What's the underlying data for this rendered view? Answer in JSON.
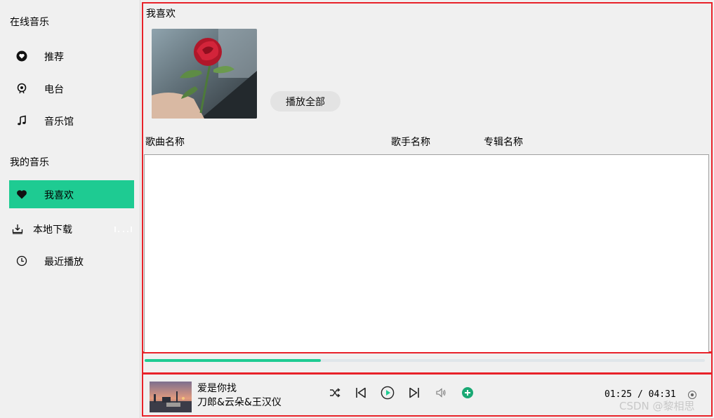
{
  "sidebar": {
    "online_title": "在线音乐",
    "online_items": [
      {
        "label": "推荐",
        "icon": "heart-circle-icon"
      },
      {
        "label": "电台",
        "icon": "radio-icon"
      },
      {
        "label": "音乐馆",
        "icon": "music-note-icon"
      }
    ],
    "my_title": "我的音乐",
    "my_items": [
      {
        "label": "我喜欢",
        "icon": "heart-icon",
        "active": true
      },
      {
        "label": "本地下载",
        "icon": "download-icon"
      },
      {
        "label": "最近播放",
        "icon": "clock-icon"
      }
    ]
  },
  "main": {
    "title": "我喜欢",
    "play_all": "播放全部",
    "columns": [
      "歌曲名称",
      "歌手名称",
      "专辑名称"
    ]
  },
  "progress": {
    "fraction": 0.315
  },
  "player": {
    "song_title": "爱是你找",
    "artist": "刀郎&云朵&王汉仪",
    "time": "01:25 / 04:31",
    "watermark": "CSDN @黎相思"
  },
  "colors": {
    "accent": "#1ecb92",
    "panel_border": "#e8222a",
    "play_button": "#1ecb92"
  }
}
